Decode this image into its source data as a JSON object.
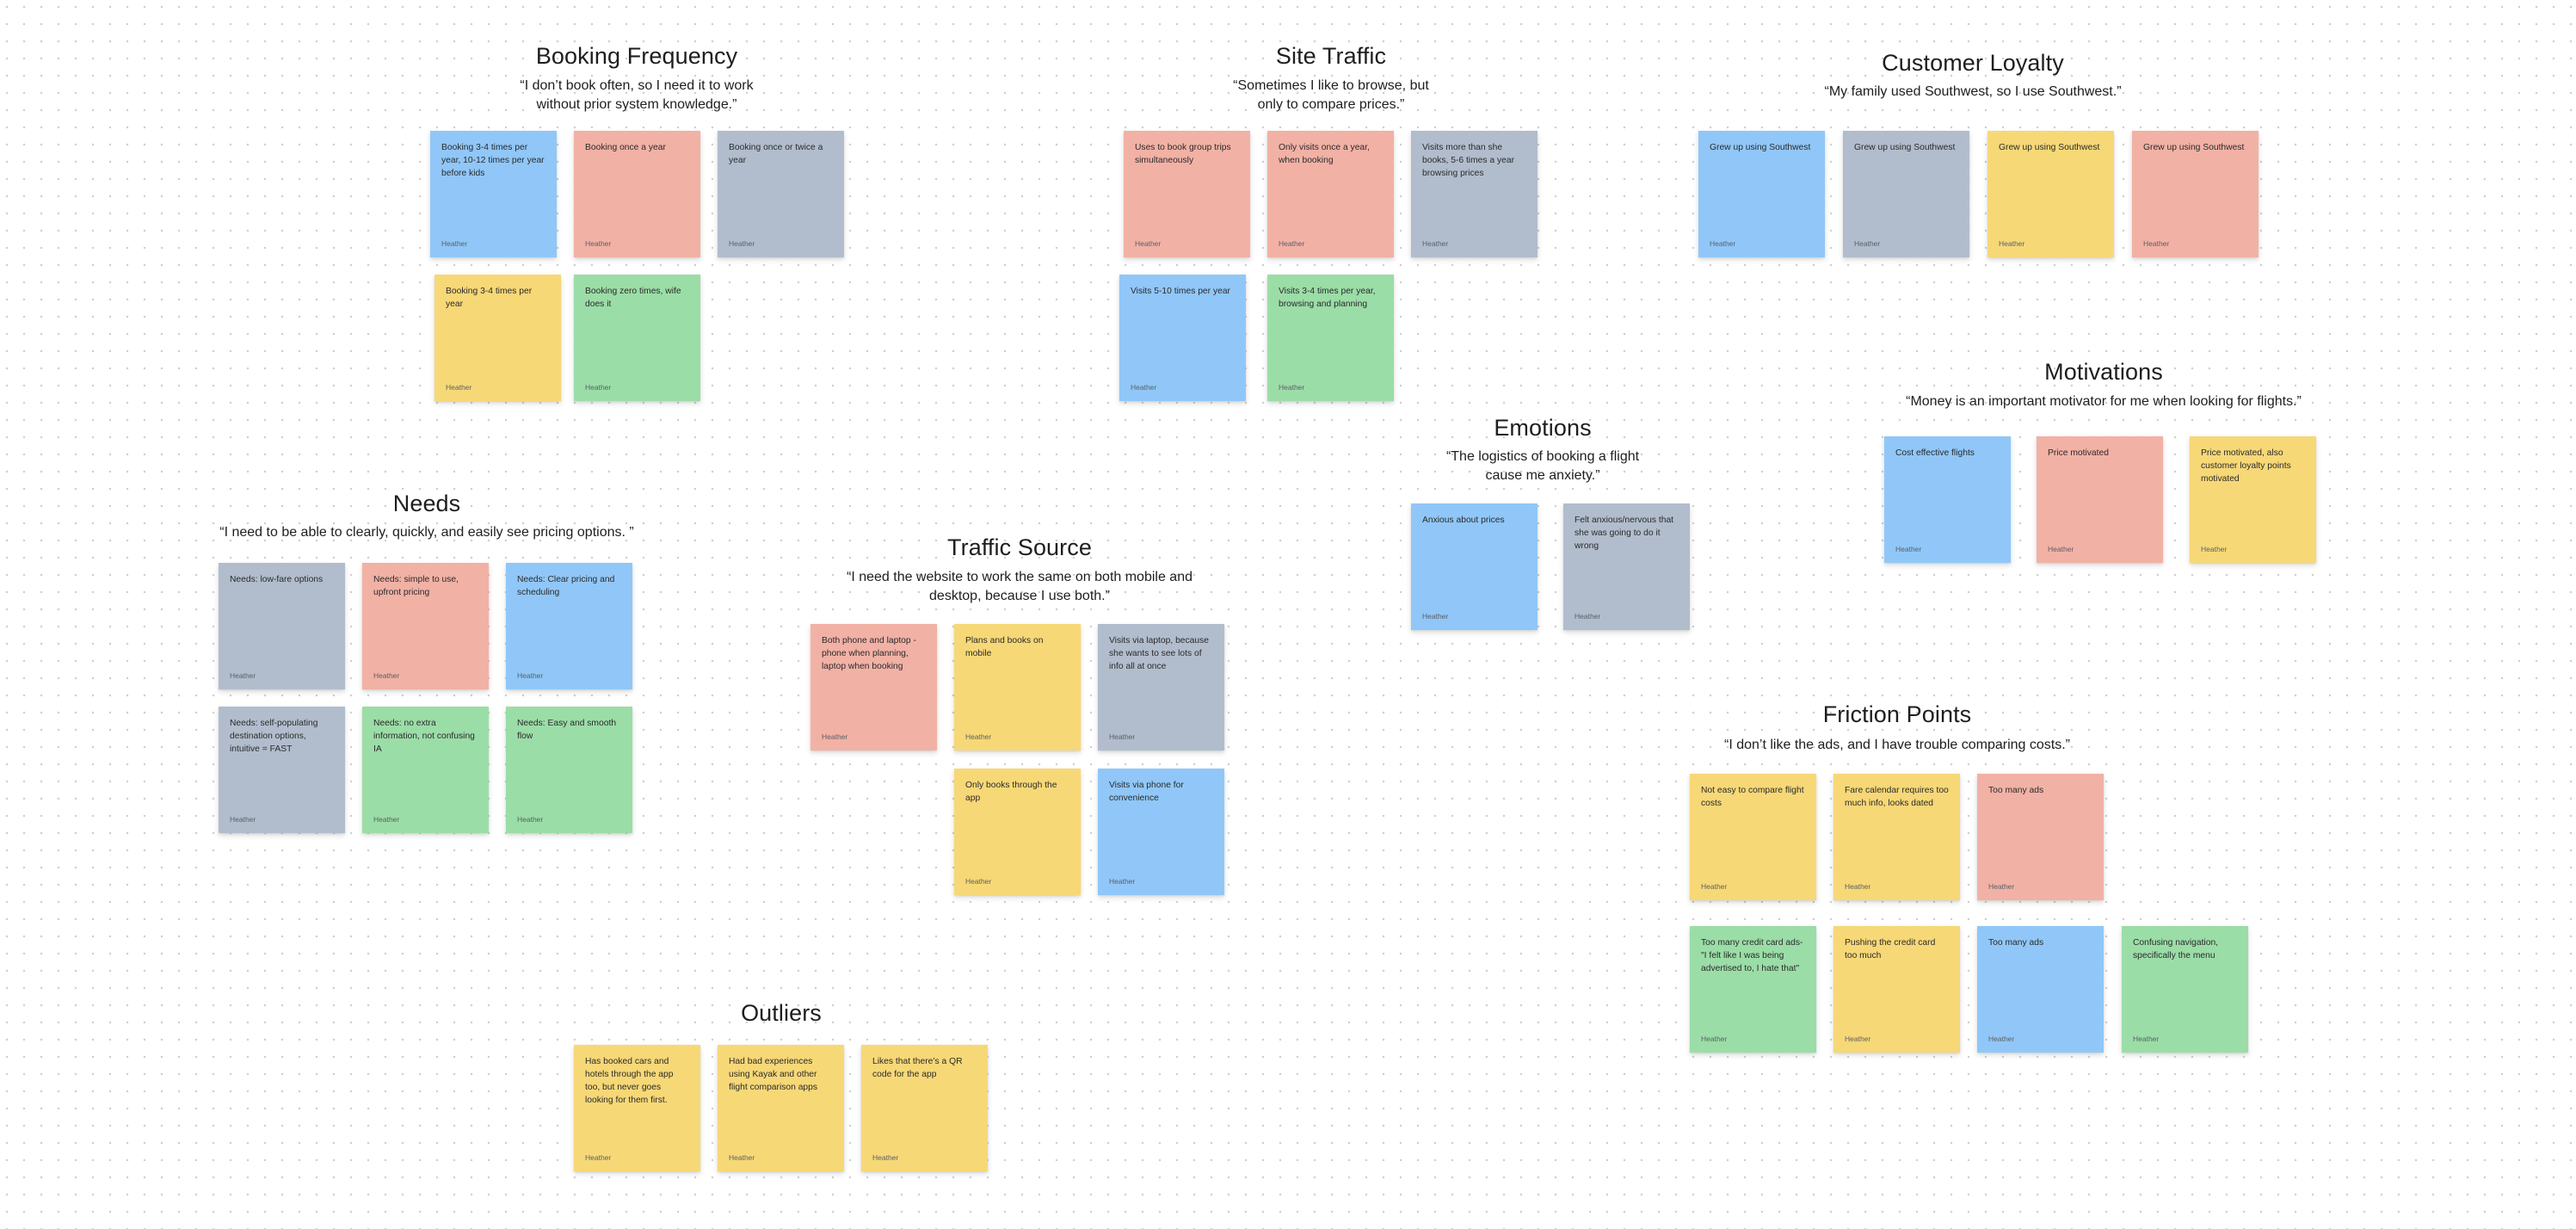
{
  "board": {
    "sections": [
      {
        "id": "booking-frequency",
        "title": "Booking Frequency",
        "quote": "“I don’t book often, so I need it to work without prior system knowledge.”",
        "stickies": [
          {
            "text": "Booking 3-4 times per year, 10-12 times per year before kids",
            "author": "Heather",
            "color": "blue"
          },
          {
            "text": "Booking once a year",
            "author": "Heather",
            "color": "red"
          },
          {
            "text": "Booking once or twice a year",
            "author": "Heather",
            "color": "gray"
          },
          {
            "text": "Booking 3-4 times per year",
            "author": "Heather",
            "color": "yellow"
          },
          {
            "text": "Booking zero times, wife does it",
            "author": "Heather",
            "color": "green"
          }
        ]
      },
      {
        "id": "site-traffic",
        "title": "Site Traffic",
        "quote": "“Sometimes I like to browse, but only to compare prices.”",
        "stickies": [
          {
            "text": "Uses to book group trips simultaneously",
            "author": "Heather",
            "color": "red"
          },
          {
            "text": "Only visits once a year, when booking",
            "author": "Heather",
            "color": "red"
          },
          {
            "text": "Visits more than she books, 5-6 times a year browsing prices",
            "author": "Heather",
            "color": "gray"
          },
          {
            "text": "Visits 5-10 times per year",
            "author": "Heather",
            "color": "blue"
          },
          {
            "text": "Visits 3-4 times per year, browsing and planning",
            "author": "Heather",
            "color": "green"
          }
        ]
      },
      {
        "id": "customer-loyalty",
        "title": "Customer Loyalty",
        "quote": "“My family used Southwest, so I use Southwest.”",
        "stickies": [
          {
            "text": "Grew up using Southwest",
            "author": "Heather",
            "color": "blue"
          },
          {
            "text": "Grew up using Southwest",
            "author": "Heather",
            "color": "gray"
          },
          {
            "text": "Grew up using Southwest",
            "author": "Heather",
            "color": "yellow"
          },
          {
            "text": "Grew up using Southwest",
            "author": "Heather",
            "color": "red"
          }
        ]
      },
      {
        "id": "motivations",
        "title": "Motivations",
        "quote": "“Money is an important motivator for me when looking for flights.”",
        "stickies": [
          {
            "text": "Cost effective flights",
            "author": "Heather",
            "color": "blue"
          },
          {
            "text": "Price motivated",
            "author": "Heather",
            "color": "red"
          },
          {
            "text": "Price motivated, also customer loyalty points motivated",
            "author": "Heather",
            "color": "yellow"
          }
        ]
      },
      {
        "id": "emotions",
        "title": "Emotions",
        "quote": "“The logistics of booking a flight cause me anxiety.”",
        "stickies": [
          {
            "text": "Anxious about prices",
            "author": "Heather",
            "color": "blue"
          },
          {
            "text": "Felt anxious/nervous that she was going to do it wrong",
            "author": "Heather",
            "color": "gray"
          }
        ]
      },
      {
        "id": "needs",
        "title": "Needs",
        "quote": "“I need to be able to clearly, quickly, and easily see pricing options. ”",
        "stickies": [
          {
            "text": "Needs: low-fare options",
            "author": "Heather",
            "color": "gray"
          },
          {
            "text": "Needs: simple to use, upfront pricing",
            "author": "Heather",
            "color": "red"
          },
          {
            "text": "Needs: Clear pricing and scheduling",
            "author": "Heather",
            "color": "blue"
          },
          {
            "text": "Needs: self-populating destination options, intuitive = FAST",
            "author": "Heather",
            "color": "gray"
          },
          {
            "text": "Needs: no extra information, not confusing IA",
            "author": "Heather",
            "color": "green"
          },
          {
            "text": "Needs: Easy and smooth flow",
            "author": "Heather",
            "color": "green"
          }
        ]
      },
      {
        "id": "traffic-source",
        "title": "Traffic Source",
        "quote": "“I need the website to work the same on both mobile and desktop, because I use both.”",
        "stickies": [
          {
            "text": "Both phone and laptop - phone when planning, laptop when booking",
            "author": "Heather",
            "color": "red"
          },
          {
            "text": "Plans and books on mobile",
            "author": "Heather",
            "color": "yellow"
          },
          {
            "text": "Visits via laptop, because she wants to see lots of info all at once",
            "author": "Heather",
            "color": "gray"
          },
          {
            "text": "Only books through the app",
            "author": "Heather",
            "color": "yellow"
          },
          {
            "text": "Visits via phone for convenience",
            "author": "Heather",
            "color": "blue"
          }
        ]
      },
      {
        "id": "friction-points",
        "title": "Friction Points",
        "quote": "“I don’t like the ads, and I have trouble comparing costs.”",
        "stickies": [
          {
            "text": "Not easy to compare flight costs",
            "author": "Heather",
            "color": "yellow"
          },
          {
            "text": "Fare calendar requires too much info, looks dated",
            "author": "Heather",
            "color": "yellow"
          },
          {
            "text": "Too many ads",
            "author": "Heather",
            "color": "red"
          },
          {
            "text": "Too many credit card ads- \"I felt like I was being advertised to, I hate that\"",
            "author": "Heather",
            "color": "green"
          },
          {
            "text": "Pushing the credit card too much",
            "author": "Heather",
            "color": "yellow"
          },
          {
            "text": "Too many ads",
            "author": "Heather",
            "color": "blue"
          },
          {
            "text": "Confusing navigation, specifically the menu",
            "author": "Heather",
            "color": "green"
          }
        ]
      },
      {
        "id": "outliers",
        "title": "Outliers",
        "quote": "",
        "stickies": [
          {
            "text": "Has booked cars and hotels through the app too, but never goes looking for them first.",
            "author": "Heather",
            "color": "yellow"
          },
          {
            "text": "Had bad experiences using Kayak and other flight comparison apps",
            "author": "Heather",
            "color": "yellow"
          },
          {
            "text": "Likes that there’s a QR code for the app",
            "author": "Heather",
            "color": "yellow"
          }
        ]
      }
    ]
  }
}
